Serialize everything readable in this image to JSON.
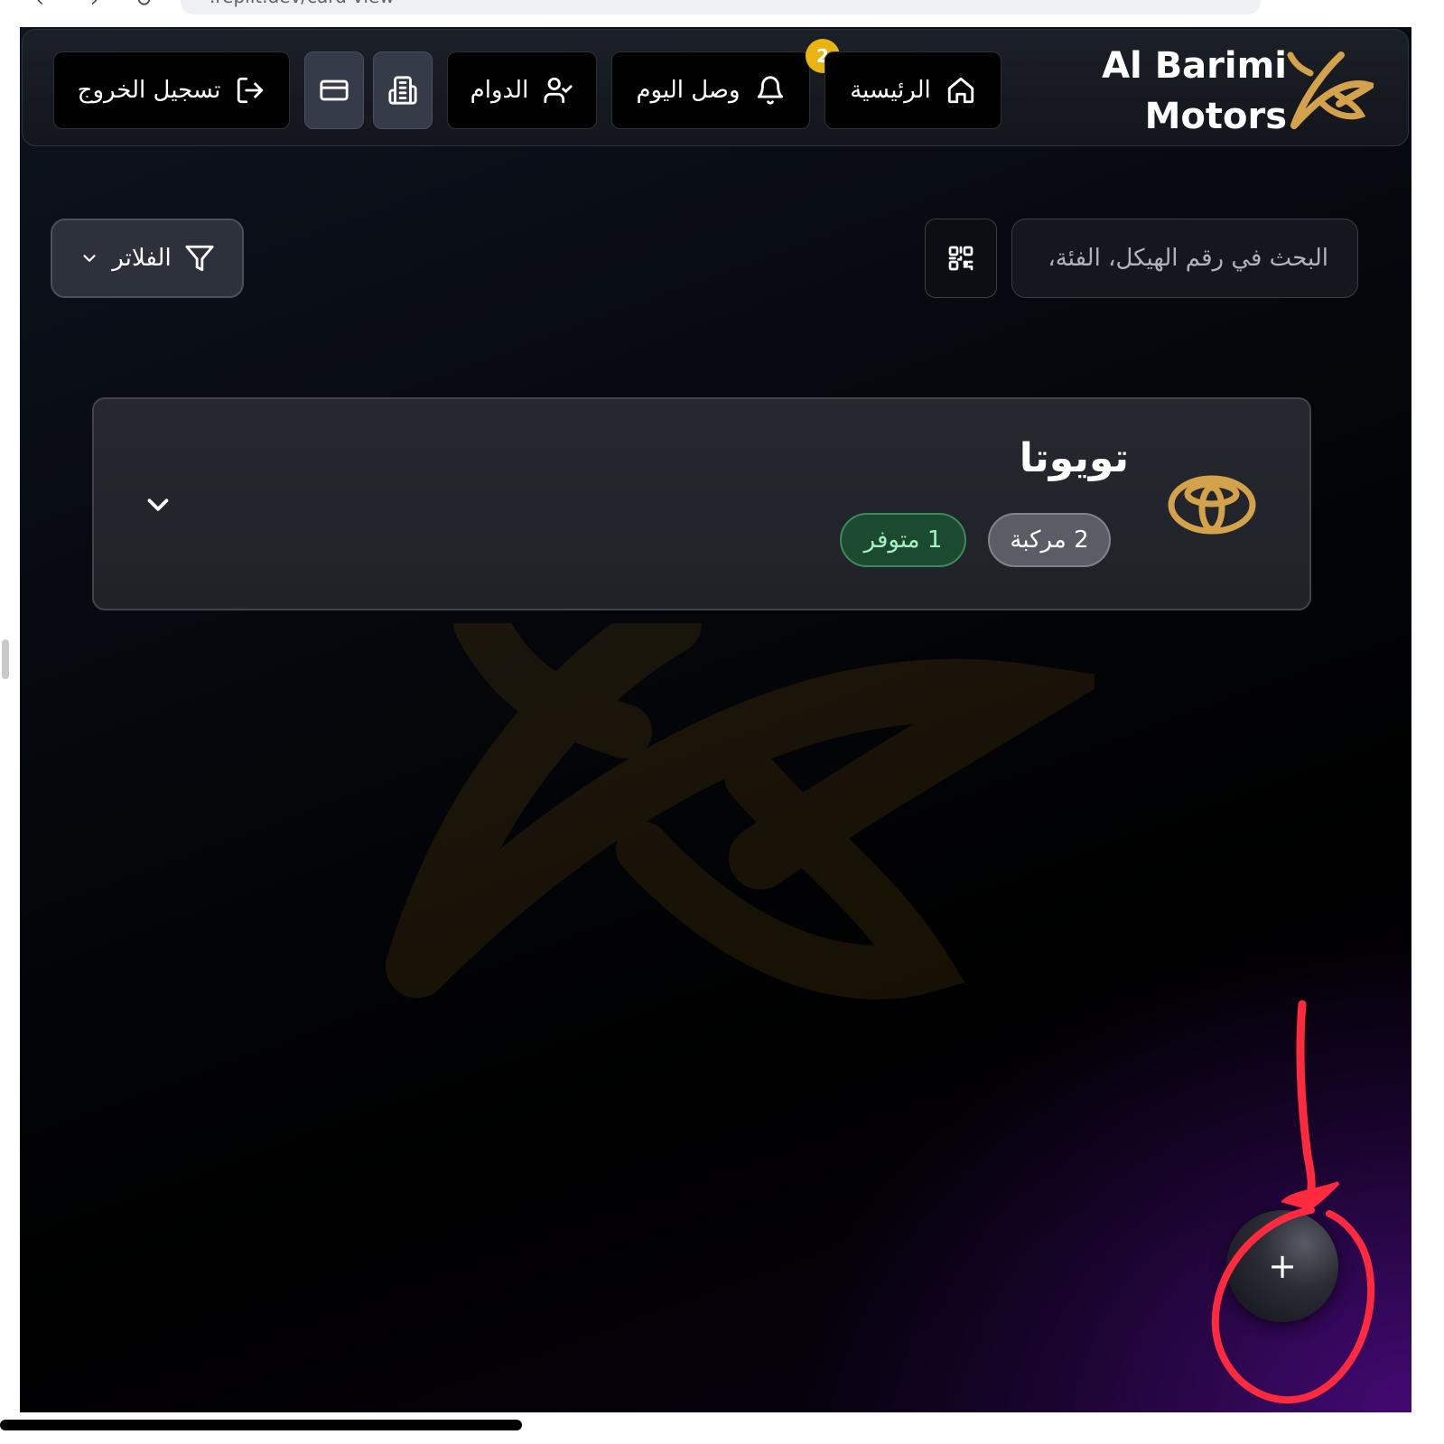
{
  "browser": {
    "url": ".replit.dev/card-view"
  },
  "header": {
    "brand_line1": "Al Barimi",
    "brand_line2": "Motors",
    "nav": {
      "home_label": "الرئيسية",
      "today_label": "وصل اليوم",
      "today_badge": "2",
      "attendance_label": "الدوام",
      "logout_label": "تسجيل الخروج"
    }
  },
  "toolbar": {
    "search_placeholder": "البحث في رقم الهيكل، الفئة،",
    "filters_label": "الفلاتر"
  },
  "brand_group": {
    "title": "تويوتا",
    "vehicles_count": "2 مركبة",
    "available_count": "1 متوفر"
  },
  "fab": {
    "label": "+"
  },
  "colors": {
    "accent_gold": "#d4a24a",
    "badge_yellow": "#e9b310",
    "annotation_red": "#ff2a3d",
    "available_green": "#a8f0c4"
  }
}
